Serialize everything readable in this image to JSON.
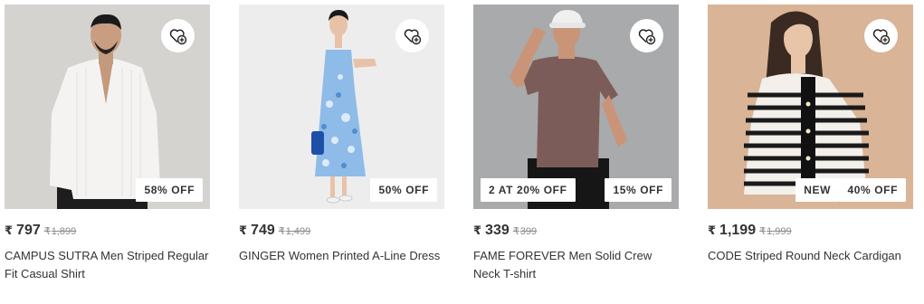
{
  "products": [
    {
      "price": "797",
      "mrp": "1,899",
      "name": "CAMPUS SUTRA Men Striped Regular Fit Casual Shirt",
      "badges": [
        "58% OFF"
      ],
      "bg_color": "#d8d5d3"
    },
    {
      "price": "749",
      "mrp": "1,499",
      "name": "GINGER Women Printed A-Line Dress",
      "badges": [
        "50% OFF"
      ],
      "bg_color": "#ededee"
    },
    {
      "price": "339",
      "mrp": "399",
      "name": "FAME FOREVER Men Solid Crew Neck T-shirt",
      "badges": [
        "2 AT 20% OFF",
        "15% OFF"
      ],
      "bg_color": "#a9aaab"
    },
    {
      "price": "1,199",
      "mrp": "1,999",
      "name": "CODE Striped Round Neck Cardigan",
      "badges": [
        "NEW",
        "40% OFF"
      ],
      "bg_color": "#d9b497"
    }
  ],
  "currency_symbol": "₹",
  "icons": {
    "wishlist": "heart-plus-icon"
  }
}
